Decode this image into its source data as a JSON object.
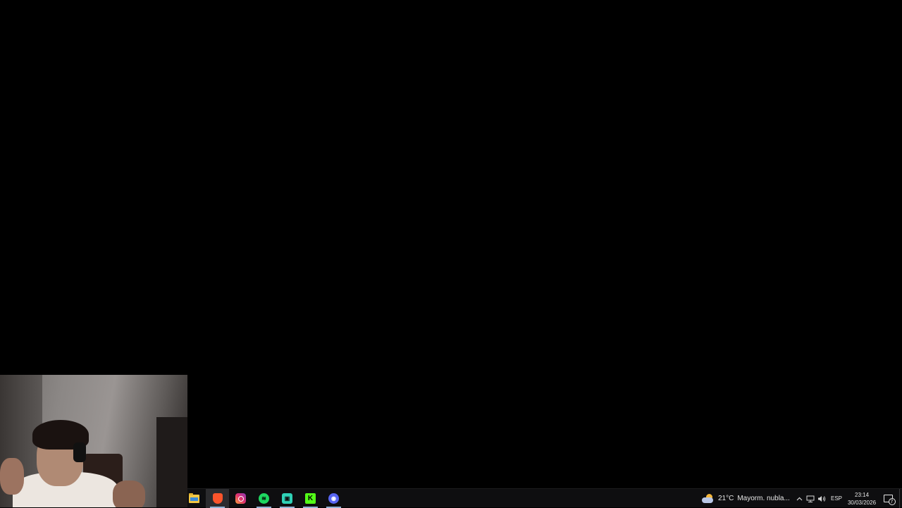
{
  "taskbar": {
    "apps": [
      {
        "name": "File Explorer",
        "icon": "folder-icon",
        "active": false,
        "running": false
      },
      {
        "name": "Brave",
        "icon": "brave-icon",
        "active": true,
        "running": true
      },
      {
        "name": "Instagram",
        "icon": "instagram-icon",
        "active": false,
        "running": false
      },
      {
        "name": "Spotify",
        "icon": "spotify-icon",
        "active": false,
        "running": true
      },
      {
        "name": "App",
        "icon": "app-icon",
        "active": false,
        "running": true
      },
      {
        "name": "Kick",
        "icon": "kick-icon",
        "active": false,
        "running": true
      },
      {
        "name": "Discord",
        "icon": "discord-icon",
        "active": false,
        "running": true
      }
    ],
    "weather": {
      "temperature": "21°C",
      "condition": "Mayorm. nubla...",
      "icon": "partly-cloudy-icon"
    },
    "tray": {
      "chevron_icon": "chevron-up-icon",
      "network_icon": "network-icon",
      "volume_icon": "volume-icon",
      "language": "ESP",
      "time": "23:14",
      "date": "30/03/2026",
      "notification_count": "7"
    }
  },
  "colors": {
    "desktop_background": "#000000",
    "taskbar_background": "#0e0e10",
    "active_indicator": "#8fb2d6"
  }
}
